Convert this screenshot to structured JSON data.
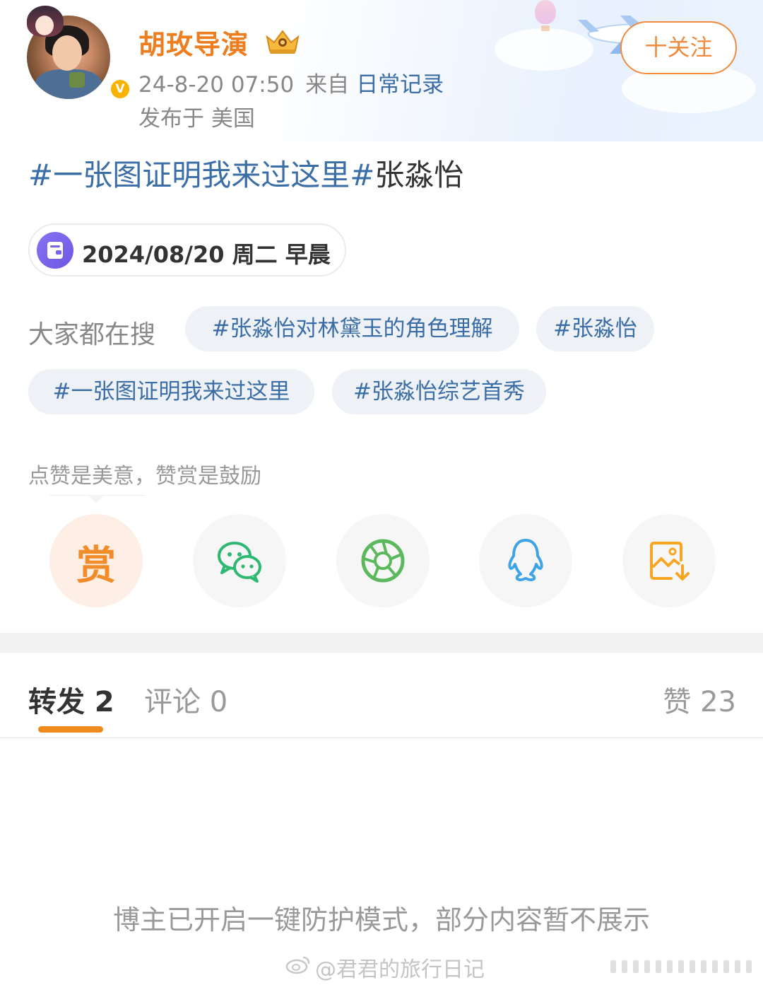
{
  "author": {
    "name": "胡玫导演",
    "timestamp": "24-8-20 07:50",
    "from_label": "来自",
    "source": "日常记录",
    "location": "发布于 美国",
    "verified_badge": "V"
  },
  "follow_button": {
    "label": "十关注"
  },
  "post": {
    "topic": "#一张图证明我来过这里#",
    "text": "张淼怡"
  },
  "date_card": {
    "text": "2024/08/20 周二 早晨"
  },
  "trending": {
    "label": "大家都在搜",
    "chips": [
      "#张淼怡对林黛玉的角色理解",
      "#张淼怡",
      "#一张图证明我来过这里",
      "#张淼怡综艺首秀"
    ]
  },
  "reward_tip": "点赞是美意，赞赏是鼓励",
  "share": {
    "reward_label": "赏",
    "icons": [
      "reward-icon",
      "wechat-icon",
      "moments-icon",
      "qq-icon",
      "save-image-icon"
    ]
  },
  "stats_tabs": {
    "repost": "转发 2",
    "comment": "评论 0",
    "like": "赞 23"
  },
  "notice": "博主已开启一键防护模式，部分内容暂不展示",
  "watermark": "@君君的旅行日记",
  "colors": {
    "orange": "#ee7d1f",
    "link_blue": "#3b6ea6",
    "wechat_green": "#2eb872",
    "moments_green": "#5cb85c",
    "qq_blue": "#3fa4e6",
    "save_orange": "#f6a623"
  }
}
